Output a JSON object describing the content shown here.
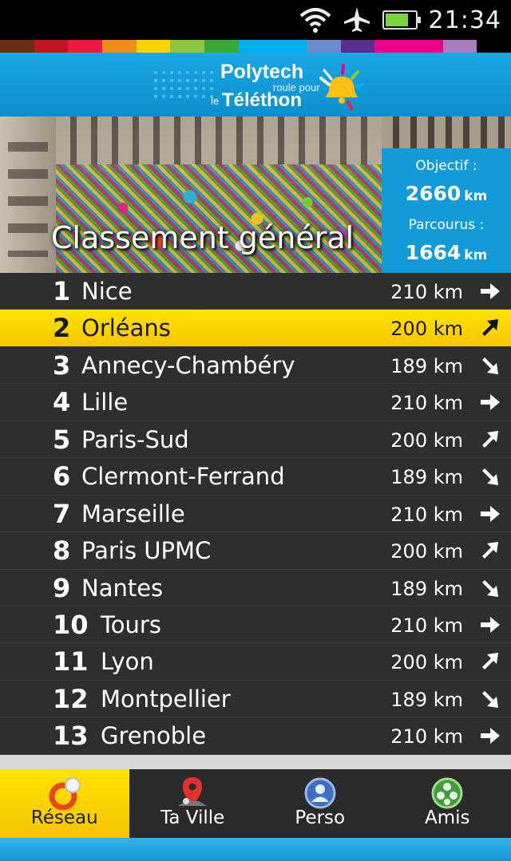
{
  "status_bar": {
    "time": "21:34",
    "icons": [
      "wifi-icon",
      "airplane-icon",
      "battery-icon"
    ],
    "battery_level": 0.8
  },
  "color_strip": [
    "#6b2d0f",
    "#c1151f",
    "#ef1a3e",
    "#f48c1c",
    "#ffd200",
    "#8cc63f",
    "#3aaa35",
    "#00aeef",
    "#00aeef",
    "#6d8ccf",
    "#5b2d8e",
    "#ec008c",
    "#ec008c",
    "#a97ec0",
    "#000000"
  ],
  "banner": {
    "logo_line1": "Polytech",
    "logo_line2": "roule pour",
    "logo_le": "le",
    "logo_line3": "Téléthon"
  },
  "header": {
    "title": "Classement général",
    "objectif_label": "Objectif :",
    "objectif_value": "2660",
    "parcourus_label": "Parcourus :",
    "parcourus_value": "1664",
    "unit": "km"
  },
  "ranking": [
    {
      "rank": "1",
      "city": "Nice",
      "distance": "210 km",
      "trend": "right",
      "highlight": false
    },
    {
      "rank": "2",
      "city": "Orléans",
      "distance": "200 km",
      "trend": "up",
      "highlight": true
    },
    {
      "rank": "3",
      "city": "Annecy-Chambéry",
      "distance": "189 km",
      "trend": "down",
      "highlight": false
    },
    {
      "rank": "4",
      "city": "Lille",
      "distance": "210 km",
      "trend": "right",
      "highlight": false
    },
    {
      "rank": "5",
      "city": "Paris-Sud",
      "distance": "200 km",
      "trend": "up",
      "highlight": false
    },
    {
      "rank": "6",
      "city": "Clermont-Ferrand",
      "distance": "189 km",
      "trend": "down",
      "highlight": false
    },
    {
      "rank": "7",
      "city": "Marseille",
      "distance": "210 km",
      "trend": "right",
      "highlight": false
    },
    {
      "rank": "8",
      "city": "Paris UPMC",
      "distance": "200 km",
      "trend": "up",
      "highlight": false
    },
    {
      "rank": "9",
      "city": "Nantes",
      "distance": "189 km",
      "trend": "down",
      "highlight": false
    },
    {
      "rank": "10",
      "city": "Tours",
      "distance": "210 km",
      "trend": "right",
      "highlight": false
    },
    {
      "rank": "11",
      "city": "Lyon",
      "distance": "200 km",
      "trend": "up",
      "highlight": false
    },
    {
      "rank": "12",
      "city": "Montpellier",
      "distance": "189 km",
      "trend": "down",
      "highlight": false
    },
    {
      "rank": "13",
      "city": "Grenoble",
      "distance": "210 km",
      "trend": "right",
      "highlight": false
    }
  ],
  "nav": {
    "tabs": [
      {
        "label": "Réseau",
        "icon": "network-icon",
        "active": true
      },
      {
        "label": "Ta Ville",
        "icon": "map-pin-icon",
        "active": false
      },
      {
        "label": "Perso",
        "icon": "person-icon",
        "active": false
      },
      {
        "label": "Amis",
        "icon": "friends-icon",
        "active": false
      }
    ]
  },
  "colors": {
    "accent_blue": "#139bd9",
    "highlight_yellow": "#ffe400",
    "list_bg": "#2e2e2e"
  }
}
